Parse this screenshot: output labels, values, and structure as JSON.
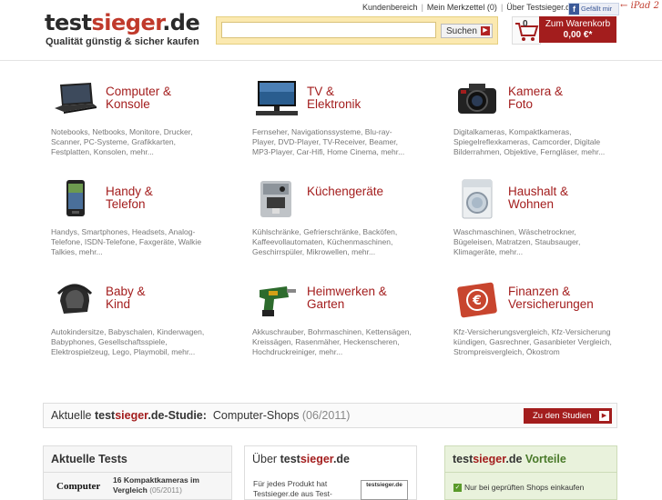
{
  "header": {
    "logo_part1": "test",
    "logo_part2": "sieger",
    "logo_part3": ".de",
    "tagline": "Qualität günstig & sicher kaufen",
    "links": [
      "Kundenbereich",
      "Mein Merkzettel (0)",
      "Über Testsieger.de"
    ],
    "facebook_label": "Gefällt mir",
    "ipad_label": "iPad 2",
    "search_placeholder": "",
    "search_button": "Suchen",
    "cart_count": "0",
    "cart_label": "Zum Warenkorb",
    "cart_sum": "0,00 €*"
  },
  "categories": [
    {
      "title1": "Computer &",
      "title2": "Konsole",
      "desc": "Notebooks, Netbooks, Monitore, Drucker, Scanner, PC-Systeme, Grafikkarten, Festplatten, Konsolen, mehr..."
    },
    {
      "title1": "TV &",
      "title2": "Elektronik",
      "desc": "Fernseher, Navigationssysteme, Blu-ray-Player, DVD-Player, TV-Receiver, Beamer, MP3-Player, Car-Hifi, Home Cinema, mehr..."
    },
    {
      "title1": "Kamera &",
      "title2": "Foto",
      "desc": "Digitalkameras, Kompaktkameras, Spiegelreflexkameras, Camcorder, Digitale Bilderrahmen, Objektive, Ferngläser, mehr..."
    },
    {
      "title1": "Handy &",
      "title2": "Telefon",
      "desc": "Handys, Smartphones, Headsets, Analog-Telefone, ISDN-Telefone, Faxgeräte, Walkie Talkies, mehr..."
    },
    {
      "title1": "Küchengeräte",
      "title2": "",
      "desc": "Kühlschränke, Gefrierschränke, Backöfen, Kaffeevollautomaten, Küchenmaschinen, Geschirrspüler, Mikrowellen, mehr..."
    },
    {
      "title1": "Haushalt &",
      "title2": "Wohnen",
      "desc": "Waschmaschinen, Wäschetrockner, Bügeleisen, Matratzen, Staubsauger, Klimageräte, mehr..."
    },
    {
      "title1": "Baby &",
      "title2": "Kind",
      "desc": "Autokindersitze, Babyschalen, Kinderwagen, Babyphones, Gesellschaftsspiele, Elektrospielzeug, Lego, Playmobil, mehr..."
    },
    {
      "title1": "Heimwerken &",
      "title2": "Garten",
      "desc": "Akkuschrauber, Bohrmaschinen, Kettensägen, Kreissägen, Rasenmäher, Heckenscheren, Hochdruckreiniger, mehr..."
    },
    {
      "title1": "Finanzen &",
      "title2": "Versicherungen",
      "desc": "Kfz-Versicherungsvergleich, Kfz-Versicherung kündigen, Gasrechner, Gasanbieter Vergleich, Strompreisvergleich, Ökostrom"
    }
  ],
  "studie": {
    "prefix": "Aktuelle",
    "brand1": "test",
    "brand2": "sieger",
    "brand3": ".de-Studie:",
    "topic": "Computer-Shops",
    "date": "(06/2011)",
    "button": "Zu den Studien"
  },
  "boxes": {
    "tests": {
      "heading": "Aktuelle Tests",
      "logo_text": "Computer",
      "item_title": "16 Kompaktkameras im",
      "item_title2": "Vergleich",
      "item_date": "(05/2011)"
    },
    "about": {
      "heading_prefix": "Über ",
      "brand1": "test",
      "brand2": "sieger",
      "brand3": ".de",
      "text1": "Für jedes Produkt hat",
      "text2": "Testsieger.de aus Test-",
      "badge": "testsieger.de"
    },
    "advantages": {
      "brand1": "test",
      "brand2": "sieger",
      "brand3": ".de",
      "heading_suffix": " Vorteile",
      "item1": "Nur bei geprüften Shops einkaufen"
    }
  },
  "colors": {
    "accent": "#a31d1d",
    "search_bg": "#fbe9b0",
    "advantage_bg": "#e9f2dc"
  }
}
